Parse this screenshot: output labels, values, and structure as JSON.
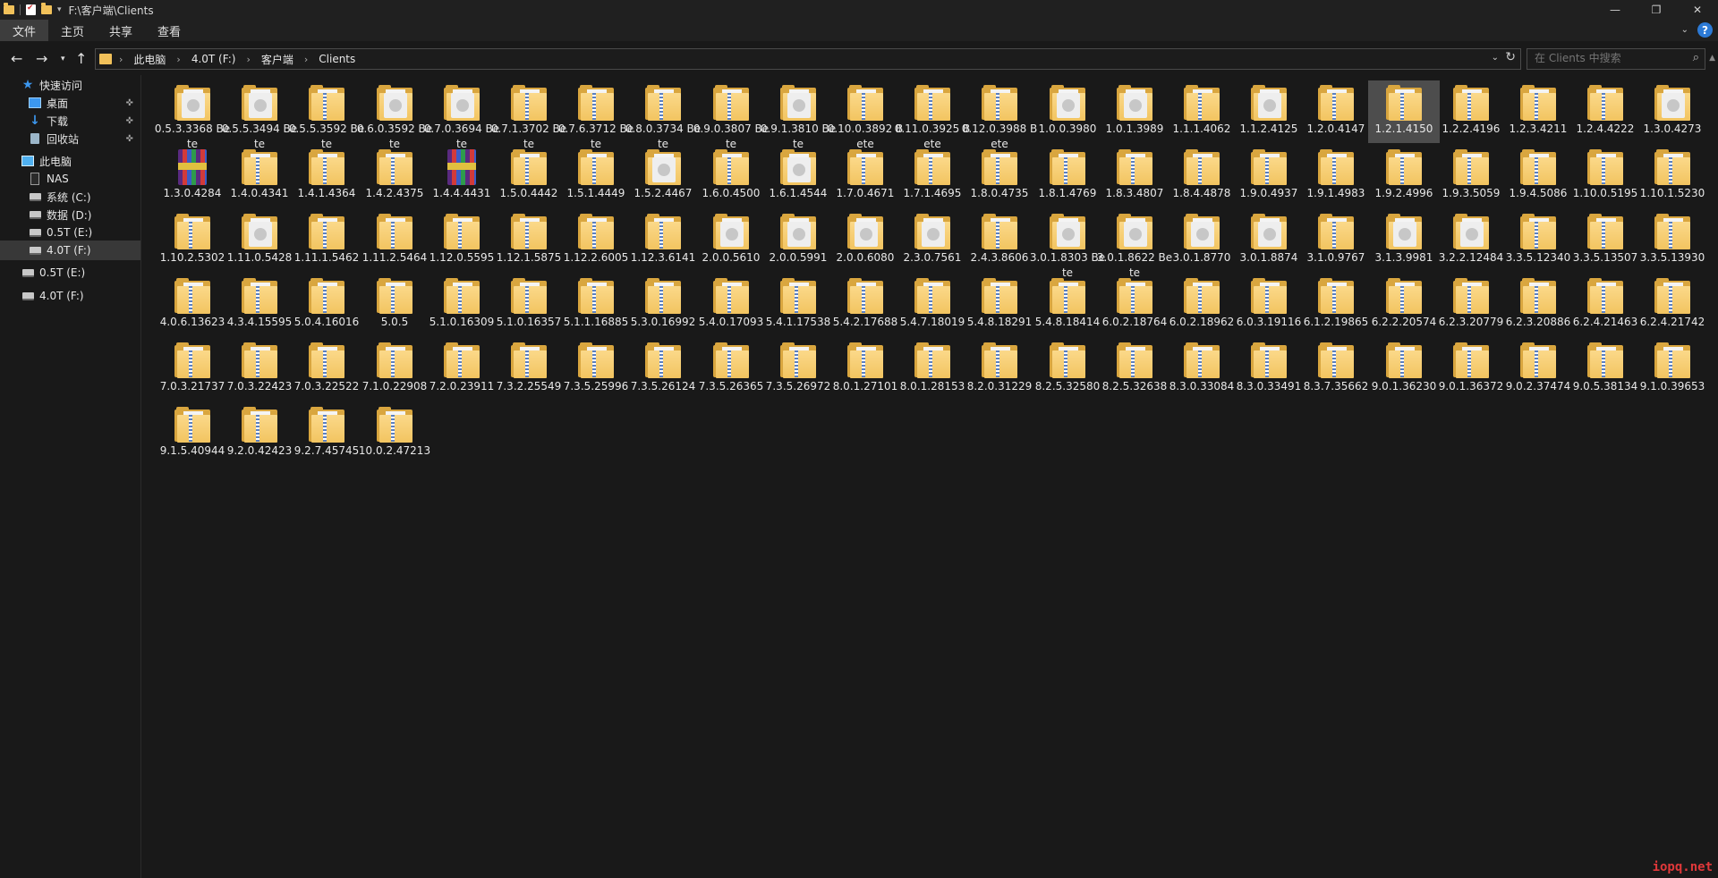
{
  "window": {
    "title": "F:\\客户端\\Clients",
    "controls": [
      "minimize-icon",
      "restore-icon",
      "close-icon"
    ]
  },
  "ribbon": {
    "tabs": [
      {
        "label": "文件",
        "active": true
      },
      {
        "label": "主页",
        "active": false
      },
      {
        "label": "共享",
        "active": false
      },
      {
        "label": "查看",
        "active": false
      }
    ],
    "help_label": "?"
  },
  "address": {
    "crumbs": [
      "此电脑",
      "4.0T (F:)",
      "客户端",
      "Clients"
    ]
  },
  "search": {
    "placeholder": "在 Clients 中搜索"
  },
  "sidebar": {
    "items": [
      {
        "label": "快速访问",
        "icon": "star-icon",
        "pinned": false,
        "selected": false
      },
      {
        "label": "桌面",
        "icon": "desktop-icon",
        "pinned": true,
        "selected": false
      },
      {
        "label": "下载",
        "icon": "download-icon",
        "pinned": true,
        "selected": false
      },
      {
        "label": "回收站",
        "icon": "recycle-bin-icon",
        "pinned": true,
        "selected": false
      },
      {
        "label": "此电脑",
        "icon": "computer-icon",
        "pinned": false,
        "selected": false
      },
      {
        "label": "NAS",
        "icon": "nas-icon",
        "pinned": false,
        "selected": false
      },
      {
        "label": "系统 (C:)",
        "icon": "drive-icon",
        "pinned": false,
        "selected": false
      },
      {
        "label": "数据 (D:)",
        "icon": "drive-icon",
        "pinned": false,
        "selected": false
      },
      {
        "label": "0.5T (E:)",
        "icon": "drive-icon",
        "pinned": false,
        "selected": false
      },
      {
        "label": "4.0T (F:)",
        "icon": "drive-icon",
        "pinned": false,
        "selected": true
      },
      {
        "label": "0.5T (E:)",
        "icon": "drive-icon",
        "pinned": false,
        "selected": false
      },
      {
        "label": "4.0T (F:)",
        "icon": "drive-icon",
        "pinned": false,
        "selected": false
      }
    ]
  },
  "items": [
    {
      "label": "0.5.3.3368 Bete",
      "icon": "doc"
    },
    {
      "label": "0.5.5.3494 Bete",
      "icon": "doc"
    },
    {
      "label": "0.5.5.3592 Bete",
      "icon": "zip"
    },
    {
      "label": "0.6.0.3592 Bete",
      "icon": "doc"
    },
    {
      "label": "0.7.0.3694 Bete",
      "icon": "doc"
    },
    {
      "label": "0.7.1.3702 Bete",
      "icon": "zip"
    },
    {
      "label": "0.7.6.3712 Bete",
      "icon": "zip"
    },
    {
      "label": "0.8.0.3734 Bete",
      "icon": "zip"
    },
    {
      "label": "0.9.0.3807 Bete",
      "icon": "zip"
    },
    {
      "label": "0.9.1.3810 Bete",
      "icon": "doc"
    },
    {
      "label": "0.10.0.3892 Bete",
      "icon": "zip"
    },
    {
      "label": "0.11.0.3925 Bete",
      "icon": "zip"
    },
    {
      "label": "0.12.0.3988 Bete",
      "icon": "zip"
    },
    {
      "label": "1.0.0.3980",
      "icon": "doc"
    },
    {
      "label": "1.0.1.3989",
      "icon": "doc"
    },
    {
      "label": "1.1.1.4062",
      "icon": "zip"
    },
    {
      "label": "1.1.2.4125",
      "icon": "doc"
    },
    {
      "label": "1.2.0.4147",
      "icon": "zip"
    },
    {
      "label": "1.2.1.4150",
      "icon": "zip",
      "selected": true
    },
    {
      "label": "1.2.2.4196",
      "icon": "zip"
    },
    {
      "label": "1.2.3.4211",
      "icon": "zip"
    },
    {
      "label": "1.2.4.4222",
      "icon": "zip"
    },
    {
      "label": "1.3.0.4273",
      "icon": "doc"
    },
    {
      "label": "1.3.0.4284",
      "icon": "rar"
    },
    {
      "label": "1.4.0.4341",
      "icon": "zip"
    },
    {
      "label": "1.4.1.4364",
      "icon": "zip"
    },
    {
      "label": "1.4.2.4375",
      "icon": "zip"
    },
    {
      "label": "1.4.4.4431",
      "icon": "rar"
    },
    {
      "label": "1.5.0.4442",
      "icon": "zip"
    },
    {
      "label": "1.5.1.4449",
      "icon": "zip"
    },
    {
      "label": "1.5.2.4467",
      "icon": "doc"
    },
    {
      "label": "1.6.0.4500",
      "icon": "zip"
    },
    {
      "label": "1.6.1.4544",
      "icon": "doc"
    },
    {
      "label": "1.7.0.4671",
      "icon": "zip"
    },
    {
      "label": "1.7.1.4695",
      "icon": "zip"
    },
    {
      "label": "1.8.0.4735",
      "icon": "zip"
    },
    {
      "label": "1.8.1.4769",
      "icon": "zip"
    },
    {
      "label": "1.8.3.4807",
      "icon": "zip"
    },
    {
      "label": "1.8.4.4878",
      "icon": "zip"
    },
    {
      "label": "1.9.0.4937",
      "icon": "zip"
    },
    {
      "label": "1.9.1.4983",
      "icon": "zip"
    },
    {
      "label": "1.9.2.4996",
      "icon": "zip"
    },
    {
      "label": "1.9.3.5059",
      "icon": "zip"
    },
    {
      "label": "1.9.4.5086",
      "icon": "zip"
    },
    {
      "label": "1.10.0.5195",
      "icon": "zip"
    },
    {
      "label": "1.10.1.5230",
      "icon": "zip"
    },
    {
      "label": "1.10.2.5302",
      "icon": "zip"
    },
    {
      "label": "1.11.0.5428",
      "icon": "doc"
    },
    {
      "label": "1.11.1.5462",
      "icon": "zip"
    },
    {
      "label": "1.11.2.5464",
      "icon": "zip"
    },
    {
      "label": "1.12.0.5595",
      "icon": "zip"
    },
    {
      "label": "1.12.1.5875",
      "icon": "zip"
    },
    {
      "label": "1.12.2.6005",
      "icon": "zip"
    },
    {
      "label": "1.12.3.6141",
      "icon": "zip"
    },
    {
      "label": "2.0.0.5610",
      "icon": "doc"
    },
    {
      "label": "2.0.0.5991",
      "icon": "doc"
    },
    {
      "label": "2.0.0.6080",
      "icon": "doc"
    },
    {
      "label": "2.3.0.7561",
      "icon": "doc"
    },
    {
      "label": "2.4.3.8606",
      "icon": "zip"
    },
    {
      "label": "3.0.1.8303 Bete",
      "icon": "doc"
    },
    {
      "label": "3.0.1.8622 Bete",
      "icon": "doc"
    },
    {
      "label": "3.0.1.8770",
      "icon": "doc"
    },
    {
      "label": "3.0.1.8874",
      "icon": "doc"
    },
    {
      "label": "3.1.0.9767",
      "icon": "zip"
    },
    {
      "label": "3.1.3.9981",
      "icon": "doc"
    },
    {
      "label": "3.2.2.12484",
      "icon": "doc"
    },
    {
      "label": "3.3.5.12340",
      "icon": "zip"
    },
    {
      "label": "3.3.5.13507",
      "icon": "zip"
    },
    {
      "label": "3.3.5.13930",
      "icon": "zip"
    },
    {
      "label": "4.0.6.13623",
      "icon": "zip"
    },
    {
      "label": "4.3.4.15595",
      "icon": "zip"
    },
    {
      "label": "5.0.4.16016",
      "icon": "zip"
    },
    {
      "label": "5.0.5",
      "icon": "zip"
    },
    {
      "label": "5.1.0.16309",
      "icon": "zip"
    },
    {
      "label": "5.1.0.16357",
      "icon": "zip"
    },
    {
      "label": "5.1.1.16885",
      "icon": "zip"
    },
    {
      "label": "5.3.0.16992",
      "icon": "zip"
    },
    {
      "label": "5.4.0.17093",
      "icon": "zip"
    },
    {
      "label": "5.4.1.17538",
      "icon": "zip"
    },
    {
      "label": "5.4.2.17688",
      "icon": "zip"
    },
    {
      "label": "5.4.7.18019",
      "icon": "zip"
    },
    {
      "label": "5.4.8.18291",
      "icon": "zip"
    },
    {
      "label": "5.4.8.18414",
      "icon": "zip"
    },
    {
      "label": "6.0.2.18764",
      "icon": "zip"
    },
    {
      "label": "6.0.2.18962",
      "icon": "zip"
    },
    {
      "label": "6.0.3.19116",
      "icon": "zip"
    },
    {
      "label": "6.1.2.19865",
      "icon": "zip"
    },
    {
      "label": "6.2.2.20574",
      "icon": "zip"
    },
    {
      "label": "6.2.3.20779",
      "icon": "zip"
    },
    {
      "label": "6.2.3.20886",
      "icon": "zip"
    },
    {
      "label": "6.2.4.21463",
      "icon": "zip"
    },
    {
      "label": "6.2.4.21742",
      "icon": "zip"
    },
    {
      "label": "7.0.3.21737",
      "icon": "zip"
    },
    {
      "label": "7.0.3.22423",
      "icon": "zip"
    },
    {
      "label": "7.0.3.22522",
      "icon": "zip"
    },
    {
      "label": "7.1.0.22908",
      "icon": "zip"
    },
    {
      "label": "7.2.0.23911",
      "icon": "zip"
    },
    {
      "label": "7.3.2.25549",
      "icon": "zip"
    },
    {
      "label": "7.3.5.25996",
      "icon": "zip"
    },
    {
      "label": "7.3.5.26124",
      "icon": "zip"
    },
    {
      "label": "7.3.5.26365",
      "icon": "zip"
    },
    {
      "label": "7.3.5.26972",
      "icon": "zip"
    },
    {
      "label": "8.0.1.27101",
      "icon": "zip"
    },
    {
      "label": "8.0.1.28153",
      "icon": "zip"
    },
    {
      "label": "8.2.0.31229",
      "icon": "zip"
    },
    {
      "label": "8.2.5.32580",
      "icon": "zip"
    },
    {
      "label": "8.2.5.32638",
      "icon": "zip"
    },
    {
      "label": "8.3.0.33084",
      "icon": "zip"
    },
    {
      "label": "8.3.0.33491",
      "icon": "zip"
    },
    {
      "label": "8.3.7.35662",
      "icon": "zip"
    },
    {
      "label": "9.0.1.36230",
      "icon": "zip"
    },
    {
      "label": "9.0.1.36372",
      "icon": "zip"
    },
    {
      "label": "9.0.2.37474",
      "icon": "zip"
    },
    {
      "label": "9.0.5.38134",
      "icon": "zip"
    },
    {
      "label": "9.1.0.39653",
      "icon": "zip"
    },
    {
      "label": "9.1.5.40944",
      "icon": "zip"
    },
    {
      "label": "9.2.0.42423",
      "icon": "zip"
    },
    {
      "label": "9.2.7.45745",
      "icon": "zip"
    },
    {
      "label": "10.0.2.47213",
      "icon": "zip"
    }
  ],
  "watermark": "iopq.net"
}
